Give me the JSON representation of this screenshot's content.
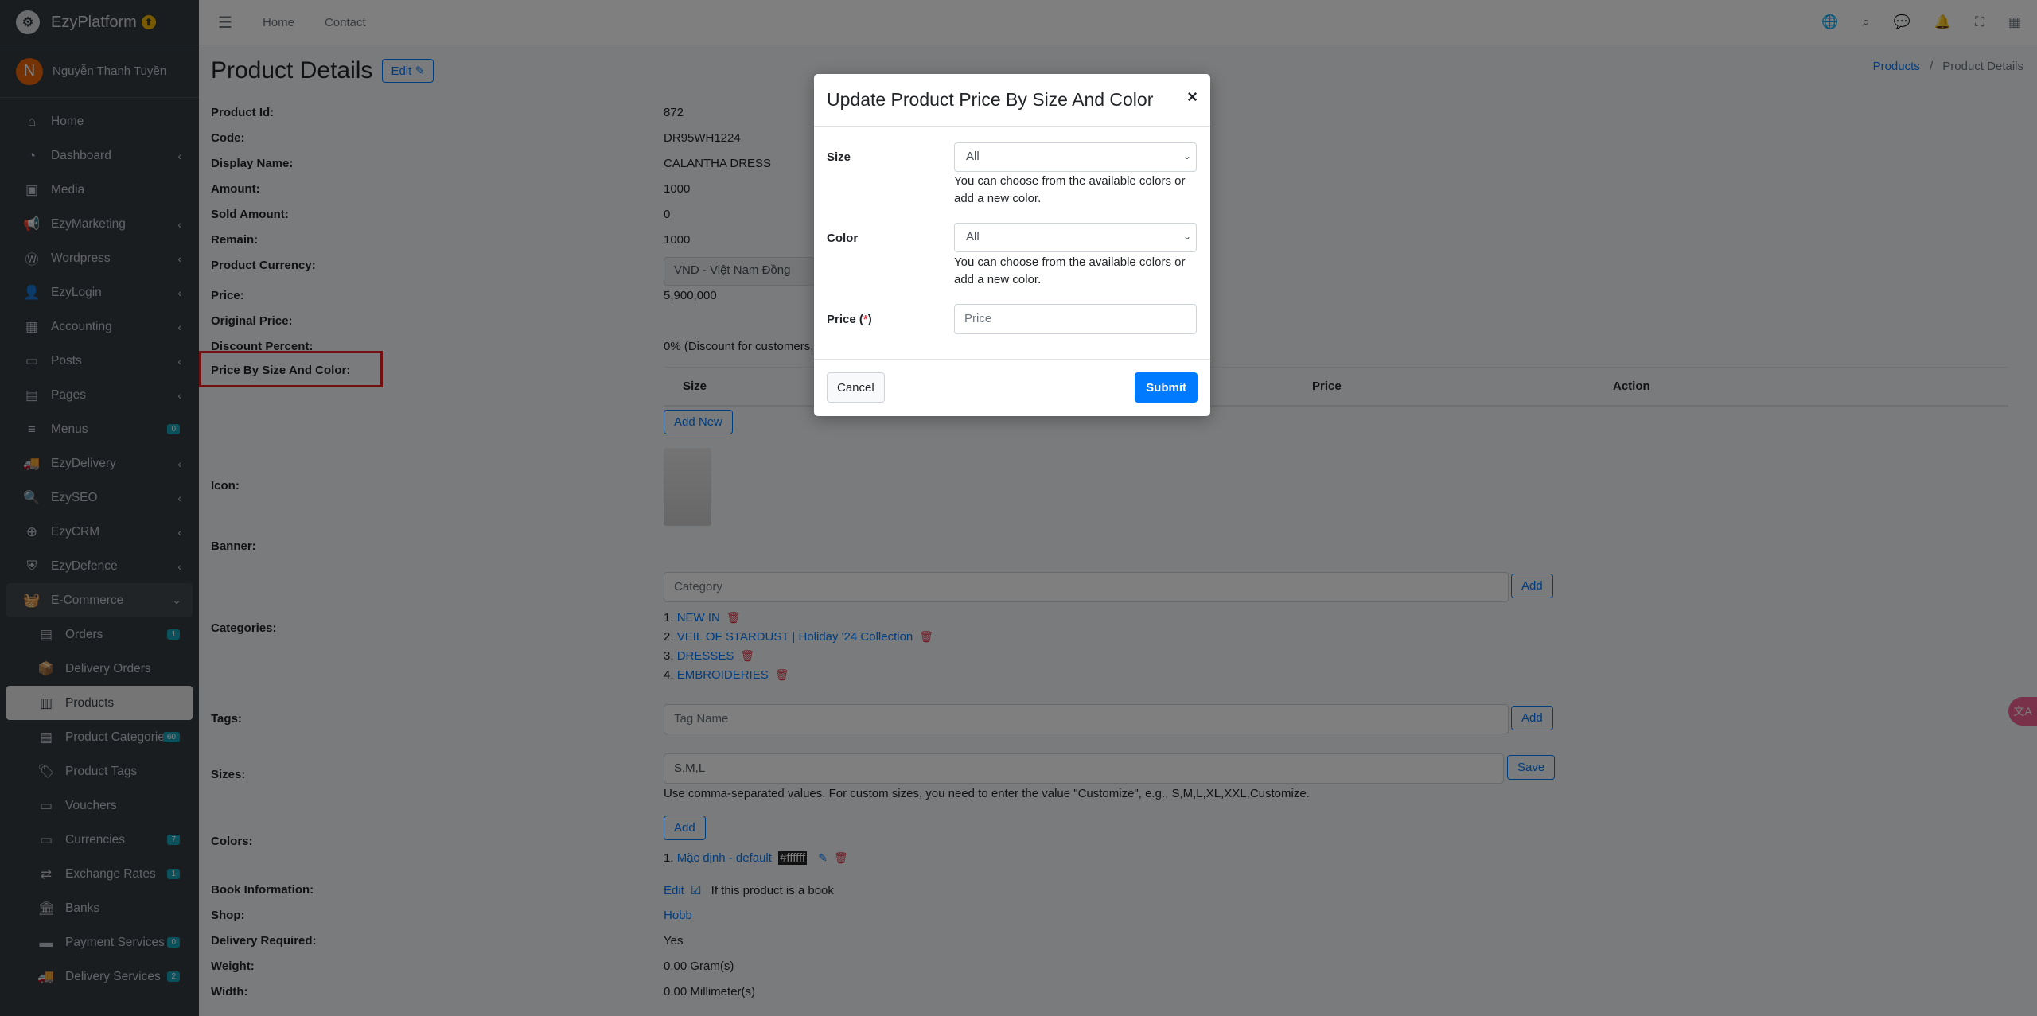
{
  "brand": {
    "name": "EzyPlatform",
    "logo_letter": "⚙",
    "badge": "⬆"
  },
  "user": {
    "initial": "N",
    "name": "Nguyễn Thanh Tuyền"
  },
  "sidebar": {
    "items": [
      {
        "label": "Home",
        "icon": "home-icon",
        "glyph": "⌂"
      },
      {
        "label": "Dashboard",
        "icon": "dashboard-icon",
        "glyph": "◔"
      },
      {
        "label": "Media",
        "icon": "media-icon",
        "glyph": "▣"
      },
      {
        "label": "EzyMarketing",
        "icon": "megaphone-icon",
        "glyph": "📢"
      },
      {
        "label": "Wordpress",
        "icon": "wordpress-icon",
        "glyph": "Ⓦ"
      },
      {
        "label": "EzyLogin",
        "icon": "user-lock-icon",
        "glyph": "👤"
      },
      {
        "label": "Accounting",
        "icon": "calculator-icon",
        "glyph": "▦"
      },
      {
        "label": "Posts",
        "icon": "posts-icon",
        "glyph": "▭"
      },
      {
        "label": "Pages",
        "icon": "book-icon",
        "glyph": "▤"
      },
      {
        "label": "Menus",
        "icon": "bars-icon",
        "glyph": "≡",
        "count": "0"
      },
      {
        "label": "EzyDelivery",
        "icon": "truck-icon",
        "glyph": "🚚"
      },
      {
        "label": "EzySEO",
        "icon": "search-plus-icon",
        "glyph": "🔍"
      },
      {
        "label": "EzyCRM",
        "icon": "crm-icon",
        "glyph": "⊕"
      },
      {
        "label": "EzyDefence",
        "icon": "shield-icon",
        "glyph": "⛨"
      },
      {
        "label": "E-Commerce",
        "icon": "basket-icon",
        "glyph": "🧺"
      }
    ],
    "sub_items": [
      {
        "label": "Orders",
        "icon": "orders-icon",
        "glyph": "▤",
        "count": "1"
      },
      {
        "label": "Delivery Orders",
        "icon": "delivery-orders-icon",
        "glyph": "📦"
      },
      {
        "label": "Products",
        "icon": "products-icon",
        "glyph": "▥"
      },
      {
        "label": "Product Categories",
        "icon": "categories-icon",
        "glyph": "▤",
        "count": "60"
      },
      {
        "label": "Product Tags",
        "icon": "tags-icon",
        "glyph": "🏷"
      },
      {
        "label": "Vouchers",
        "icon": "voucher-icon",
        "glyph": "▭"
      },
      {
        "label": "Currencies",
        "icon": "currency-icon",
        "glyph": "▭",
        "count": "7"
      },
      {
        "label": "Exchange Rates",
        "icon": "exchange-icon",
        "glyph": "⇄",
        "count": "1"
      },
      {
        "label": "Banks",
        "icon": "bank-icon",
        "glyph": "🏛"
      },
      {
        "label": "Payment Services",
        "icon": "payment-icon",
        "glyph": "▬",
        "count": "0"
      },
      {
        "label": "Delivery Services",
        "icon": "delivery-service-icon",
        "glyph": "🚚",
        "count": "2"
      }
    ]
  },
  "topbar": {
    "home": "Home",
    "contact": "Contact"
  },
  "page": {
    "title": "Product Details",
    "edit": "Edit ✎"
  },
  "breadcrumb": {
    "parent": "Products",
    "sep": "/",
    "current": "Product Details"
  },
  "fields": {
    "product_id": {
      "label": "Product Id:",
      "value": "872"
    },
    "code": {
      "label": "Code:",
      "value": "DR95WH1224"
    },
    "display_name": {
      "label": "Display Name:",
      "value": "CALANTHA DRESS"
    },
    "amount": {
      "label": "Amount:",
      "value": "1000"
    },
    "sold_amount": {
      "label": "Sold Amount:",
      "value": "0"
    },
    "remain": {
      "label": "Remain:",
      "value": "1000"
    },
    "currency": {
      "label": "Product Currency:",
      "value": "VND - Việt Nam Đồng"
    },
    "price": {
      "label": "Price:",
      "value": "5,900,000"
    },
    "original_price": {
      "label": "Original Price:"
    },
    "discount": {
      "label": "Discount Percent:",
      "value": "0% (Discount for customers,"
    },
    "price_by_size": {
      "label": "Price By Size And Color:"
    },
    "icon": {
      "label": "Icon:"
    },
    "banner": {
      "label": "Banner:"
    },
    "categories": {
      "label": "Categories:"
    },
    "tags": {
      "label": "Tags:"
    },
    "sizes": {
      "label": "Sizes:"
    },
    "colors": {
      "label": "Colors:"
    },
    "book": {
      "label": "Book Information:",
      "edit": "Edit",
      "note": "If this product is a book"
    },
    "shop": {
      "label": "Shop:",
      "value": "Hobb"
    },
    "delivery": {
      "label": "Delivery Required:",
      "value": "Yes"
    },
    "weight": {
      "label": "Weight:",
      "value": "0.00 Gram(s)"
    },
    "width": {
      "label": "Width:",
      "value": "0.00 Millimeter(s)"
    }
  },
  "price_table": {
    "columns": [
      "Size",
      "Price",
      "Action"
    ],
    "add_new": "Add New"
  },
  "category": {
    "placeholder": "Category",
    "add": "Add",
    "items": [
      "1. ",
      "2. ",
      "3. ",
      "4. "
    ],
    "links": [
      "NEW IN",
      "VEIL OF STARDUST | Holiday '24 Collection",
      "DRESSES",
      "EMBROIDERIES"
    ]
  },
  "tag": {
    "placeholder": "Tag Name",
    "add": "Add"
  },
  "size": {
    "value": "S,M,L",
    "save": "Save",
    "hint": "Use comma-separated values. For custom sizes, you need to enter the value \"Customize\", e.g., S,M,L,XL,XXL,Customize."
  },
  "color": {
    "add": "Add",
    "item_prefix": "1. ",
    "item_name": "Mặc định - default",
    "item_code": "#ffffff"
  },
  "modal": {
    "title": "Update Product Price By Size And Color",
    "close": "×",
    "size_label": "Size",
    "size_value": "All",
    "size_hint": "You can choose from the available colors or add a new color.",
    "color_label": "Color",
    "color_value": "All",
    "color_hint": "You can choose from the available colors or add a new color.",
    "price_label": "Price (",
    "price_req": "*",
    "price_end": ")",
    "price_placeholder": "Price",
    "cancel": "Cancel",
    "submit": "Submit"
  }
}
